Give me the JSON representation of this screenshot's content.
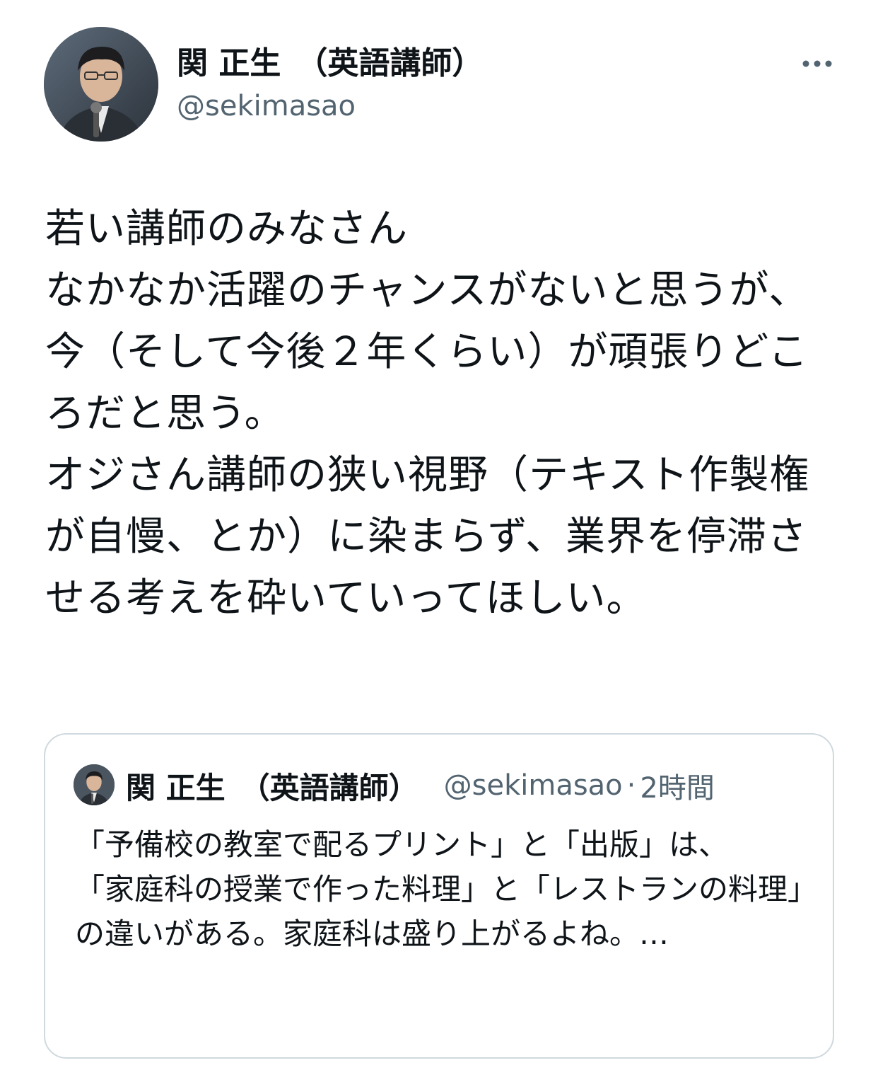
{
  "author": {
    "display_name": "関 正生　（英語講師）",
    "handle": "@sekimasao",
    "avatar_alt": "profile-photo"
  },
  "tweet": {
    "text": "若い講師のみなさん\nなかなか活躍のチャンスがないと思うが、今（そして今後２年くらい）が頑張りどころだと思う。\nオジさん講師の狭い視野（テキスト作製権が自慢、とか）に染まらず、業界を停滞させる考えを砕いていってほしい。"
  },
  "quoted_tweet": {
    "display_name": "関 正生　（英語講師）",
    "handle": "@sekimasao",
    "separator": "·",
    "time": "2時間",
    "text": "「予備校の教室で配るプリント」と「出版」は、\n「家庭科の授業で作った料理」と「レストランの料理」の違いがある。家庭科は盛り上がるよね。…"
  },
  "icons": {
    "more": "more-horizontal-icon"
  },
  "colors": {
    "text_primary": "#0f1419",
    "text_secondary": "#536471",
    "border": "#cfd9de"
  }
}
